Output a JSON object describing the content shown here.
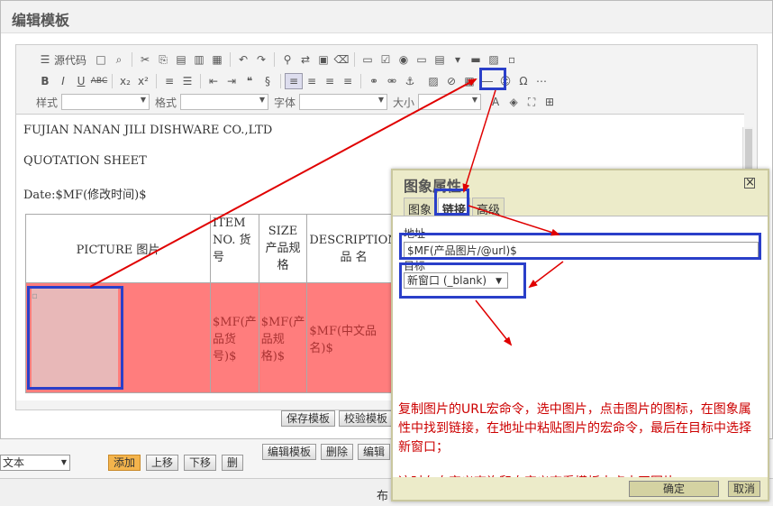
{
  "background": {
    "type_select": "文本",
    "add": "添加",
    "up": "上移",
    "down": "下移",
    "del": "删",
    "edit_template": "编辑模板",
    "delete": "删除",
    "edit_short": "编辑",
    "bottom_label": "布"
  },
  "window": {
    "title": "编辑模板"
  },
  "toolbar": {
    "source": "源代码",
    "style_label": "样式",
    "format_label": "格式",
    "font_label": "字体",
    "size_label": "大小"
  },
  "editor": {
    "line1": "FUJIAN NANAN JILI DISHWARE CO.,LTD",
    "line2": "QUOTATION      SHEET",
    "line3": "Date:$MF(修改时间)$",
    "headers": [
      "PICTURE      图片",
      "ITEM NO. 货号",
      "SIZE 产品规格",
      "DESCRIPTION 品  名"
    ],
    "cells": [
      "$MF(产品货号)$",
      "$MF(产品规格)$",
      "$MF(中文品名)$"
    ],
    "bottom_text": "        ",
    "save_template": "保存模板",
    "check_template": "校验模板"
  },
  "dialog": {
    "title": "图象属性",
    "tabs": [
      "图象",
      "链接",
      "高级"
    ],
    "url_label": "地址",
    "url_value": "$MF(产品图片/@url)$",
    "target_label": "目标",
    "target_value": "新窗口 (_blank)",
    "note1": "复制图片的URL宏命令，选中图片，点击图片的图标，在图象属性中找到链接，在地址中粘贴图片的宏命令，最后在目标中选择新窗口；",
    "note2": "这时在自定义查询和自定义查看模板中点击开图片。",
    "ok": "确定",
    "cancel": "取消"
  },
  "colors": {
    "annotation_red": "#e00000",
    "highlight_blue": "#2a3fc9",
    "cell_red": "#ff7d7d",
    "dialog_bg": "#ecebc9"
  }
}
